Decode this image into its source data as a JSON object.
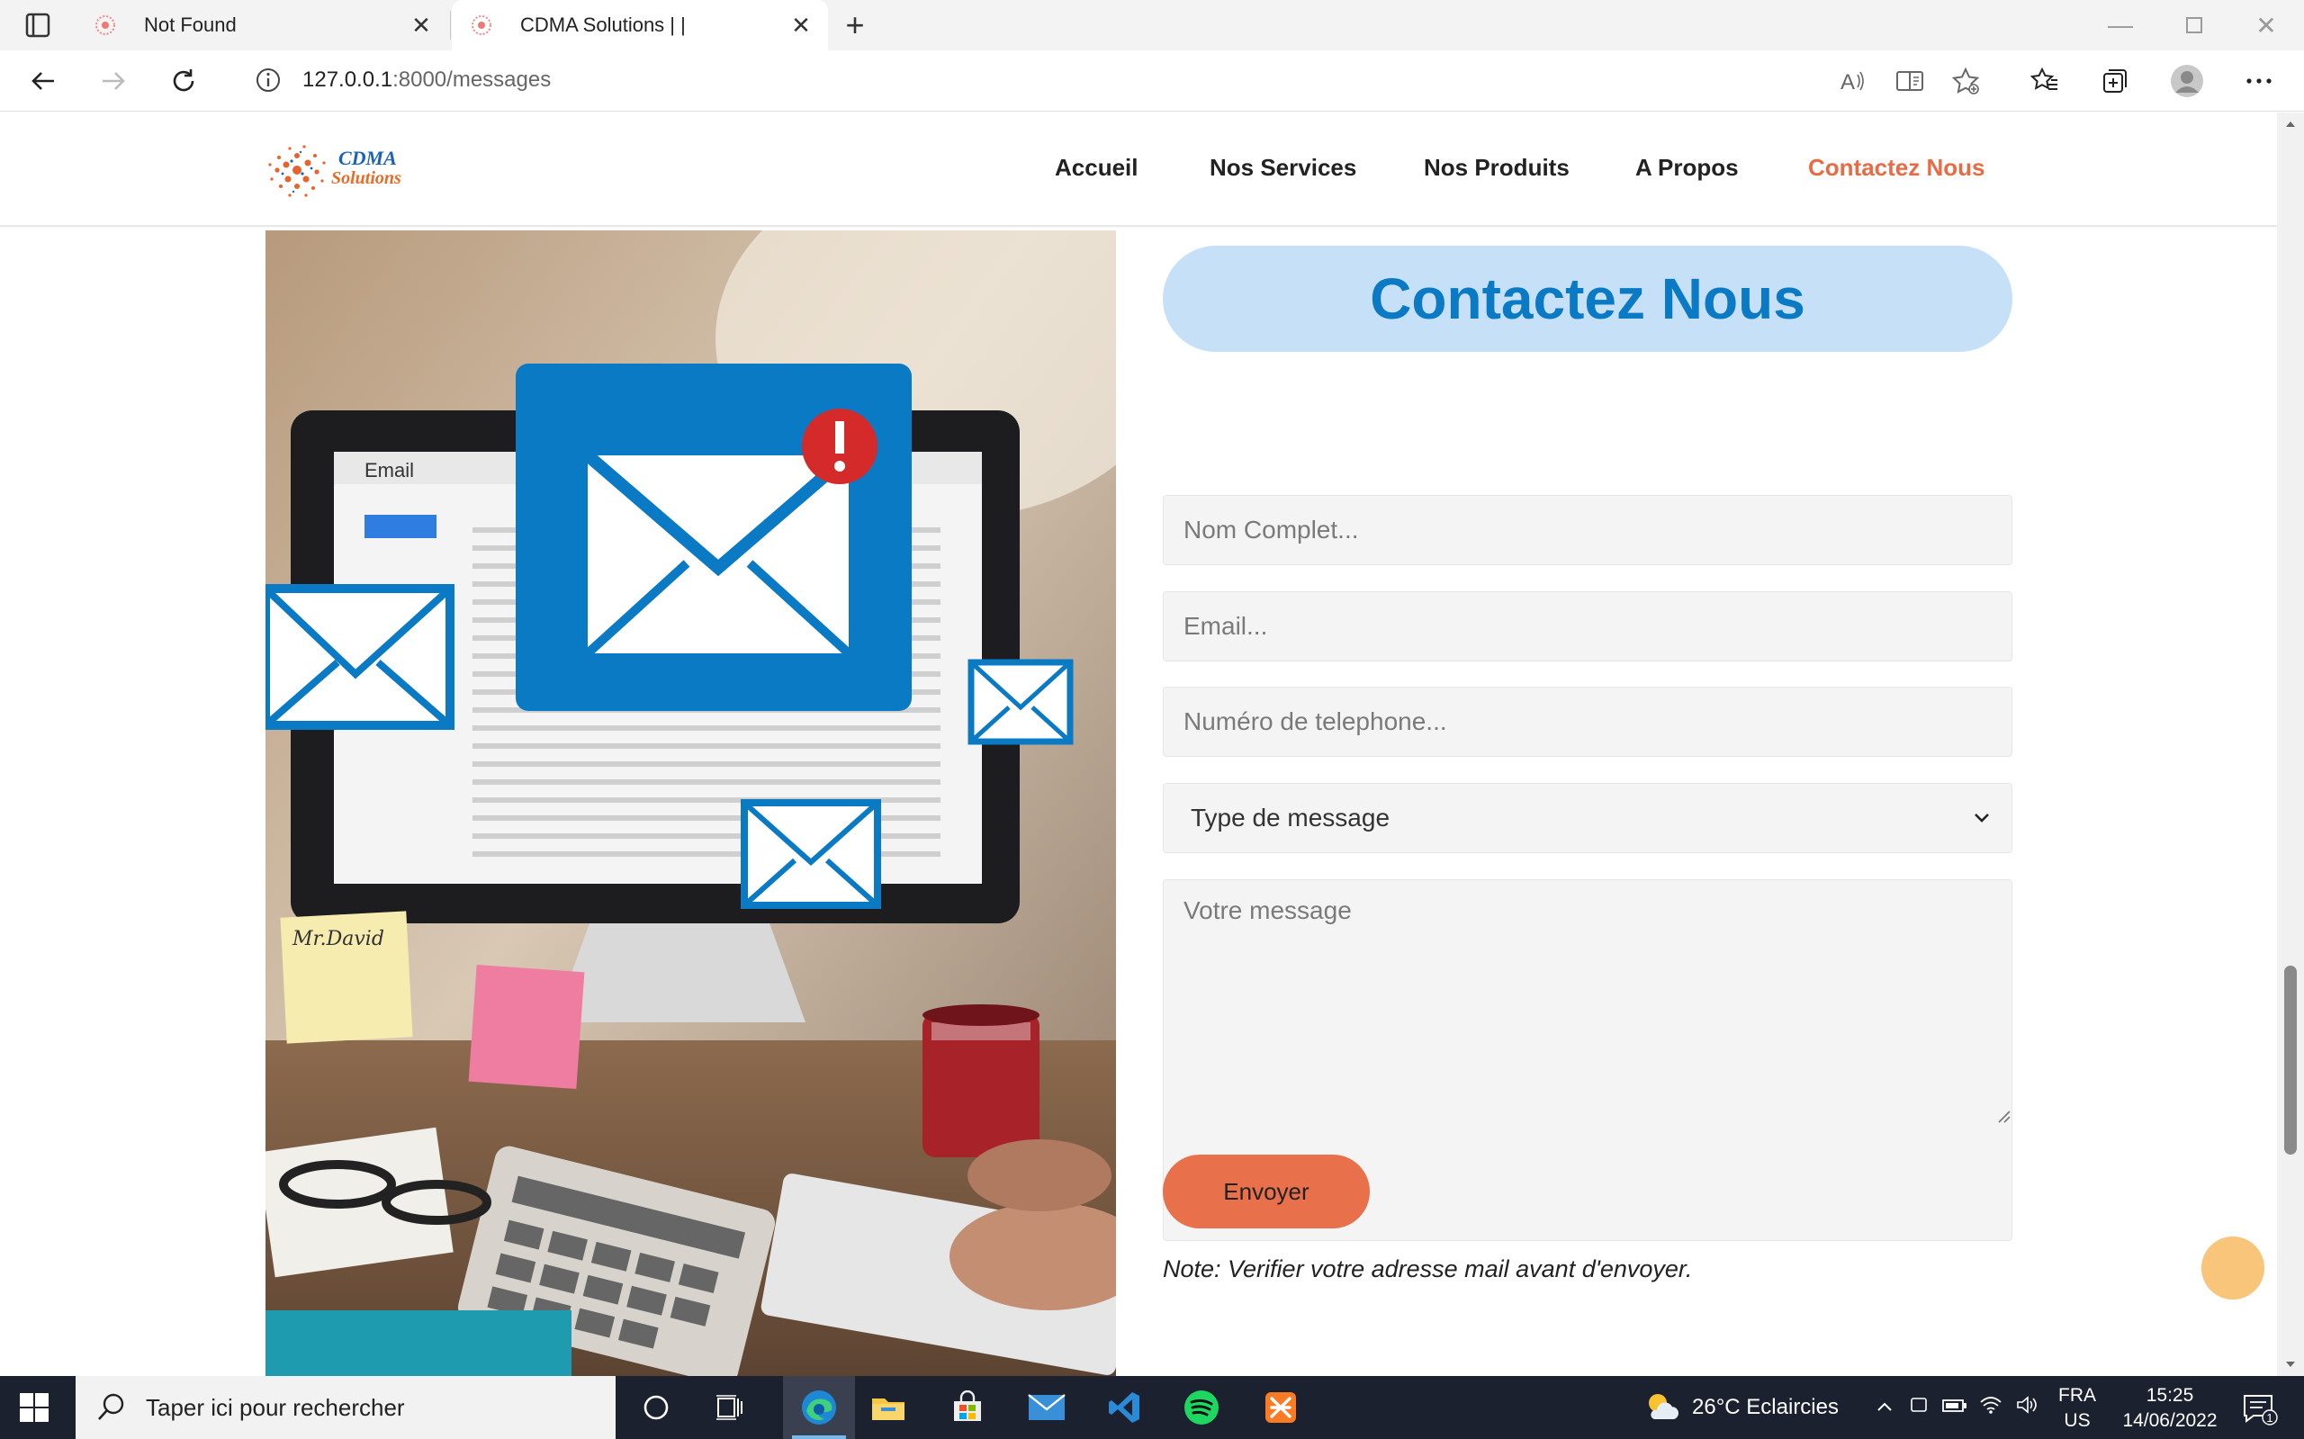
{
  "browser": {
    "tabs": [
      {
        "title": "Not Found",
        "active": false
      },
      {
        "title": "CDMA Solutions | |",
        "active": true
      }
    ],
    "url_host": "127.0.0.1",
    "url_path": ":8000/messages"
  },
  "site": {
    "logo_line1": "CDMA",
    "logo_line2": "Solutions",
    "nav": [
      {
        "label": "Accueil",
        "active": false
      },
      {
        "label": "Nos Services",
        "active": false
      },
      {
        "label": "Nos Produits",
        "active": false
      },
      {
        "label": "A Propos",
        "active": false
      },
      {
        "label": "Contactez Nous",
        "active": true
      }
    ]
  },
  "image": {
    "email_window_title": "Email",
    "sticky_note_text": "Mr.David"
  },
  "form": {
    "title": "Contactez Nous",
    "name_placeholder": "Nom Complet...",
    "email_placeholder": "Email...",
    "phone_placeholder": "Numéro de telephone...",
    "type_selected": "Type de message",
    "message_placeholder": "Votre message",
    "submit_label": "Envoyer",
    "note": "Note: Verifier votre adresse mail avant d'envoyer."
  },
  "taskbar": {
    "search_placeholder": "Taper ici pour rechercher",
    "weather": "26°C  Eclaircies",
    "lang_line1": "FRA",
    "lang_line2": "US",
    "time": "15:25",
    "date": "14/06/2022",
    "notification_count": "1"
  },
  "colors": {
    "accent_orange": "#e8704a",
    "title_blue": "#0b7ac4",
    "title_bg": "#c6e0f7"
  }
}
